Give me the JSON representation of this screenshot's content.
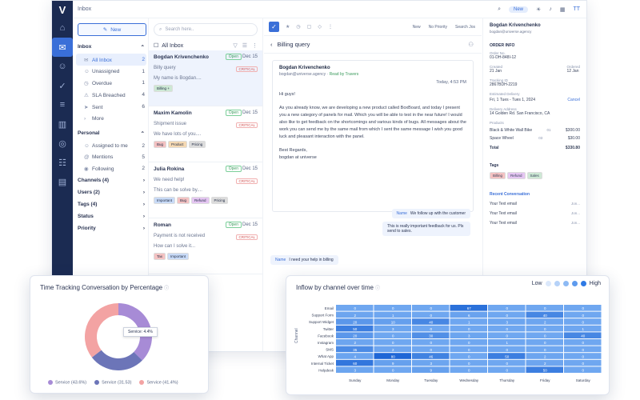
{
  "app": {
    "title": "Inbox",
    "new_badge": "New",
    "rail_icons": [
      "home-icon",
      "inbox-icon",
      "contacts-icon",
      "tasks-icon",
      "layers-icon",
      "bank-icon",
      "broadcast-icon",
      "team-icon",
      "reports-icon"
    ]
  },
  "folders": {
    "new_label": "New",
    "inbox_header": "Inbox",
    "inbox_items": [
      {
        "label": "All Inbox",
        "count": "2",
        "icon": "inbox-icon",
        "active": true
      },
      {
        "label": "Unassigned",
        "count": "1",
        "icon": "user-icon"
      },
      {
        "label": "Overdue",
        "count": "1",
        "icon": "clock-icon"
      },
      {
        "label": "SLA Breached",
        "count": "4",
        "icon": "alert-icon"
      },
      {
        "label": "Sent",
        "count": "6",
        "icon": "send-icon"
      },
      {
        "label": "More",
        "count": "",
        "icon": "chevron-icon"
      }
    ],
    "personal_header": "Personal",
    "personal_items": [
      {
        "label": "Assigned to me",
        "count": "2",
        "icon": "user-icon"
      },
      {
        "label": "Mentions",
        "count": "5",
        "icon": "at-icon"
      },
      {
        "label": "Following",
        "count": "2",
        "icon": "eye-icon"
      }
    ],
    "groups": [
      "Channels (4)",
      "Users (2)",
      "Tags (4)",
      "Status",
      "Priority"
    ]
  },
  "conversations": {
    "search_placeholder": "Search here..",
    "header": "All Inbox",
    "items": [
      {
        "name": "Bogdan Krivenchenko",
        "date": "Dec 15",
        "status": "Open",
        "subject": "Billy query",
        "priority": "CRITICAL",
        "preview": "My name is Bogdan....",
        "tags": [
          "Billing +"
        ],
        "selected": true
      },
      {
        "name": "Maxim Kamolin",
        "date": "Dec 15",
        "status": "Open",
        "subject": "Shipment issue",
        "priority": "CRITICAL",
        "preview": "We have lots of you....",
        "tags": [
          "Bug",
          "Product",
          "Pricing"
        ]
      },
      {
        "name": "Julia Rokina",
        "date": "Dec 15",
        "status": "Open",
        "subject": "We need help!",
        "priority": "CRITICAL",
        "preview": "This can be solve by....",
        "tags": [
          "Important",
          "Bug",
          "Refund",
          "Pricing"
        ]
      },
      {
        "name": "Roman",
        "date": "Dec 15",
        "status": "Open",
        "subject": "Payment is not received",
        "priority": "CRITICAL",
        "preview": "How can I solve it...",
        "tags": [
          "Tax",
          "Important"
        ]
      }
    ]
  },
  "detail": {
    "subject": "Billing query",
    "filters": [
      "New",
      "No Priority",
      "Search Jos"
    ],
    "message": {
      "from": "Bogdan Krivenchenko",
      "to": "bogdan@universe.agency",
      "via": "Read by Travers",
      "time": "Today, 4:53 PM",
      "body": [
        "Hi guys!",
        "As you already know, we are developing a new product called BoxBoard, and today I present you a new category of panels for mail. Which you will be able to test in the near future! I would also like to get feedback on the shortcomings and various kinds of bugs. All messages about the work you can send me by the same mail from which I sent the same message I wish you good luck and pleasant interaction with the panel.",
        "Best Regards,\nbogdan at universe"
      ]
    },
    "outgoing": [
      {
        "label": "Name",
        "text": "We follow up with the customer"
      },
      {
        "label": "",
        "text": "This is really important feedback for us. Pls send to sales."
      }
    ],
    "incoming": {
      "label": "Name",
      "text": "I need your help in billing"
    }
  },
  "contact": {
    "name": "Bogdan Krivenchenko",
    "email": "bogdan@universe.agency",
    "order_header": "ORDER INFO",
    "order_id_label": "Order No.",
    "order_id": "01-DH-848I-12",
    "created_label": "Created",
    "created": "21 Jan",
    "ordered_label": "Ordered",
    "ordered": "12 Jan",
    "tracking_label": "Tracking ID",
    "tracking": "2867BDH-2219",
    "estimated_label": "Estimated Delivery",
    "estimated": "Fri, 1 Tues - Tues 1, 2024",
    "estimated_btn": "Cancel",
    "address_label": "Delivery Address",
    "address": "14 Golden Rd. San Francisco, CA",
    "products_label": "Products",
    "products": [
      {
        "name": "Black & White Wall Bike",
        "qty": "01",
        "price": "$300.00"
      },
      {
        "name": "Space Wheel",
        "qty": "03",
        "price": "$30.00"
      }
    ],
    "total_label": "Total",
    "total": "$330.80",
    "tags_label": "Tags",
    "tags": [
      "Billing",
      "Refund",
      "Sales"
    ],
    "recent_label": "Recent Conversation",
    "recent": [
      {
        "text": "Your Text email",
        "who": "Jon..."
      },
      {
        "text": "Your Text email",
        "who": "Jon..."
      },
      {
        "text": "Your Text email",
        "who": "Jon..."
      }
    ]
  },
  "donut": {
    "title": "Time Tracking Conversation by Percentage",
    "tooltip": "Service: 4.4%",
    "legend": [
      "Service (43.6%)",
      "Service (31.53)",
      "Service (41.4%)"
    ],
    "colors": [
      "#a78bd6",
      "#6c75b8",
      "#f3a3a3"
    ],
    "values": [
      43.6,
      31.53,
      41.4
    ]
  },
  "heatmap": {
    "title": "Inflow by channel over time",
    "low": "Low",
    "high": "High",
    "ylabel": "Channel",
    "channels": [
      "Email",
      "Support Form",
      "Support Widget",
      "Twitter",
      "Facebook",
      "Instagram",
      "SMS",
      "What App",
      "Internal Ticket",
      "Helpdesk"
    ],
    "days": [
      "Sunday",
      "Monday",
      "Tuesday",
      "Wednesday",
      "Thursday",
      "Friday",
      "Saturday"
    ],
    "values": [
      [
        0,
        0,
        0,
        67,
        0,
        0,
        0
      ],
      [
        2,
        1,
        0,
        6,
        0,
        40,
        0
      ],
      [
        20,
        10,
        40,
        1,
        3,
        2,
        0
      ],
      [
        50,
        3,
        0,
        0,
        0,
        0,
        1
      ],
      [
        20,
        0,
        30,
        3,
        0,
        0,
        40
      ],
      [
        2,
        0,
        0,
        0,
        1,
        0,
        0
      ],
      [
        35,
        2,
        0,
        0,
        0,
        0,
        0
      ],
      [
        4,
        80,
        46,
        0,
        50,
        2,
        0
      ],
      [
        60,
        9,
        3,
        0,
        0,
        2,
        0
      ],
      [
        3,
        0,
        9,
        0,
        0,
        50,
        0
      ]
    ]
  }
}
